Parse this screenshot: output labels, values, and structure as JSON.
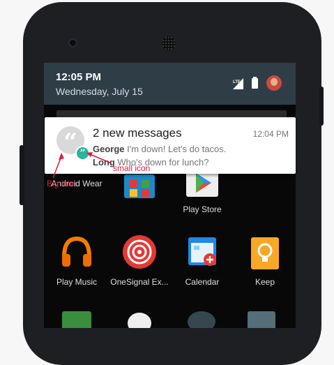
{
  "status": {
    "time": "12:05 PM",
    "date": "Wednesday, July 15"
  },
  "notification": {
    "title": "2 new messages",
    "time": "12:04 PM",
    "messages": [
      {
        "sender": "George",
        "text": "I'm down! Let's do tacos."
      },
      {
        "sender": "Long",
        "text": "Who's down for lunch?"
      }
    ],
    "big_icon_glyph": "“",
    "small_icon_glyph": "”"
  },
  "annotations": {
    "big_icon": "Big icon",
    "small_icon": "small icon"
  },
  "apps": [
    {
      "label": "Android Wear",
      "icon": "android-wear-icon"
    },
    {
      "label": "",
      "icon": "play-store-bag-icon"
    },
    {
      "label": "Play Store",
      "icon": "play-store-icon"
    },
    {
      "label": "Play Music",
      "icon": "headphones-icon"
    },
    {
      "label": "OneSignal Ex...",
      "icon": "onesignal-icon"
    },
    {
      "label": "Calendar",
      "icon": "calendar-icon"
    },
    {
      "label": "Keep",
      "icon": "lightbulb-icon"
    }
  ],
  "colors": {
    "accent_small_icon": "#2ab49a",
    "annotation": "#e0183f",
    "shade": "#2f3d46"
  }
}
